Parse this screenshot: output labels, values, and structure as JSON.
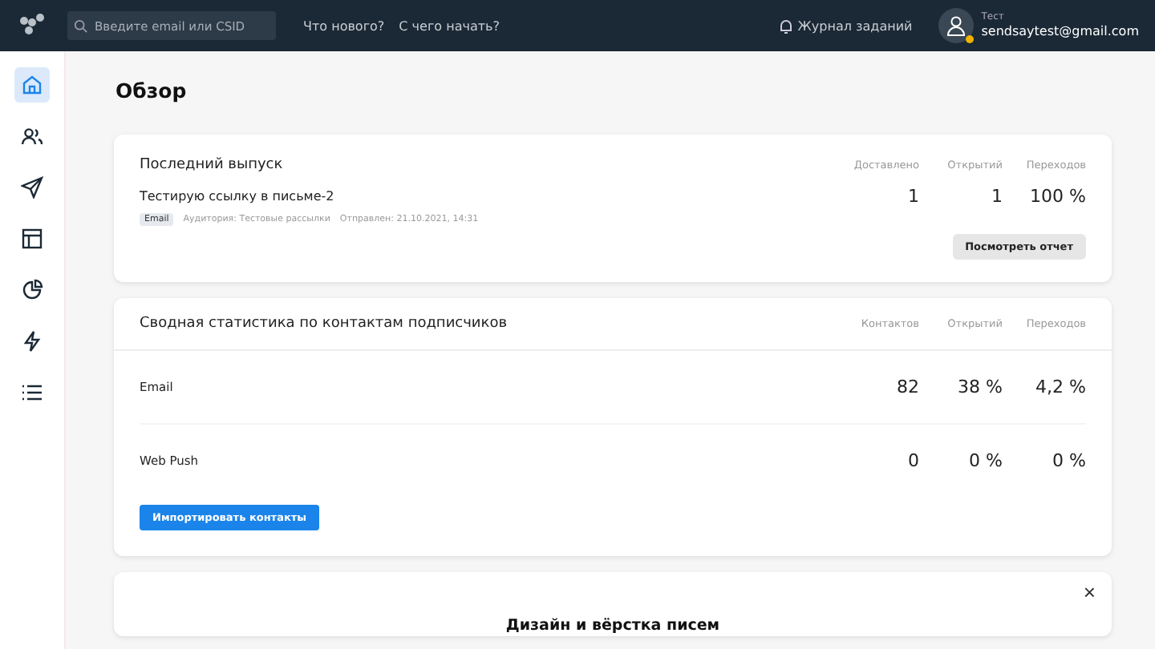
{
  "topbar": {
    "search": {
      "placeholder": "Введите email или CSID"
    },
    "links": [
      "Что нового?",
      "С чего начать?"
    ],
    "tasks": "Журнал заданий",
    "user": {
      "name": "Тест",
      "email": "sendsaytest@gmail.com"
    }
  },
  "sidebar": {
    "items": [
      {
        "selected": true
      },
      {
        "selected": false
      },
      {
        "selected": false
      },
      {
        "selected": false
      },
      {
        "selected": false
      },
      {
        "selected": false
      },
      {
        "selected": false
      }
    ]
  },
  "page_title": "Обзор",
  "last_issue": {
    "title": "Последний выпуск",
    "columns": [
      "Доставлено",
      "Открытий",
      "Переходов"
    ],
    "name": "Тестирую ссылку в письме-2",
    "tag": "Email",
    "audience": "Аудитория: Тестовые рассылки",
    "sent": "Отправлен: 21.10.2021, 14:31",
    "values": [
      "1",
      "1",
      "100 %"
    ],
    "button": "Посмотреть отчет"
  },
  "summary": {
    "title": "Сводная статистика по контактам подписчиков",
    "columns": [
      "Контактов",
      "Открытий",
      "Переходов"
    ],
    "rows": [
      {
        "label": "Email",
        "values": [
          "82",
          "38 %",
          "4,2 %"
        ]
      },
      {
        "label": "Web Push",
        "values": [
          "0",
          "0 %",
          "0 %"
        ]
      }
    ],
    "button": "Импортировать контакты"
  },
  "promo": {
    "title": "Дизайн и вёрстка писем",
    "close": "×"
  }
}
